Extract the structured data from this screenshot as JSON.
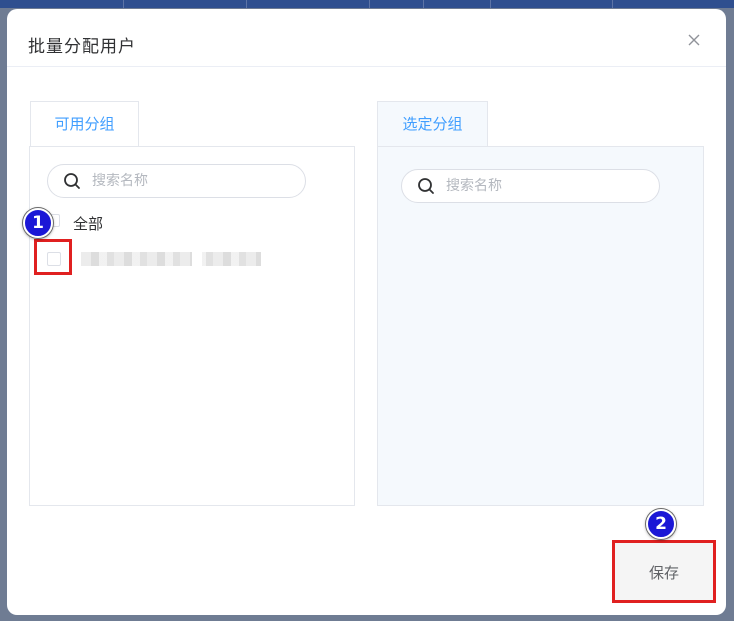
{
  "dialog": {
    "title": "批量分配用户",
    "close_icon": "close-icon"
  },
  "left_panel": {
    "tab_label": "可用分组",
    "search": {
      "placeholder": "搜索名称",
      "value": "",
      "icon": "search-icon"
    },
    "select_all": {
      "label": "全部",
      "checked": false
    },
    "items": [
      {
        "checked": false,
        "name_redacted": true
      }
    ]
  },
  "right_panel": {
    "tab_label": "选定分组",
    "search": {
      "placeholder": "搜索名称",
      "value": "",
      "icon": "search-icon"
    }
  },
  "footer": {
    "save_label": "保存"
  },
  "annotations": [
    {
      "number": "1",
      "target": "item-checkbox"
    },
    {
      "number": "2",
      "target": "save-button"
    }
  ],
  "colors": {
    "accent": "#409eff",
    "annotation_box": "#e02020",
    "badge": "#1b17d6",
    "topbar": "#2f4f8f",
    "right_panel_bg": "#f5f9fd"
  }
}
